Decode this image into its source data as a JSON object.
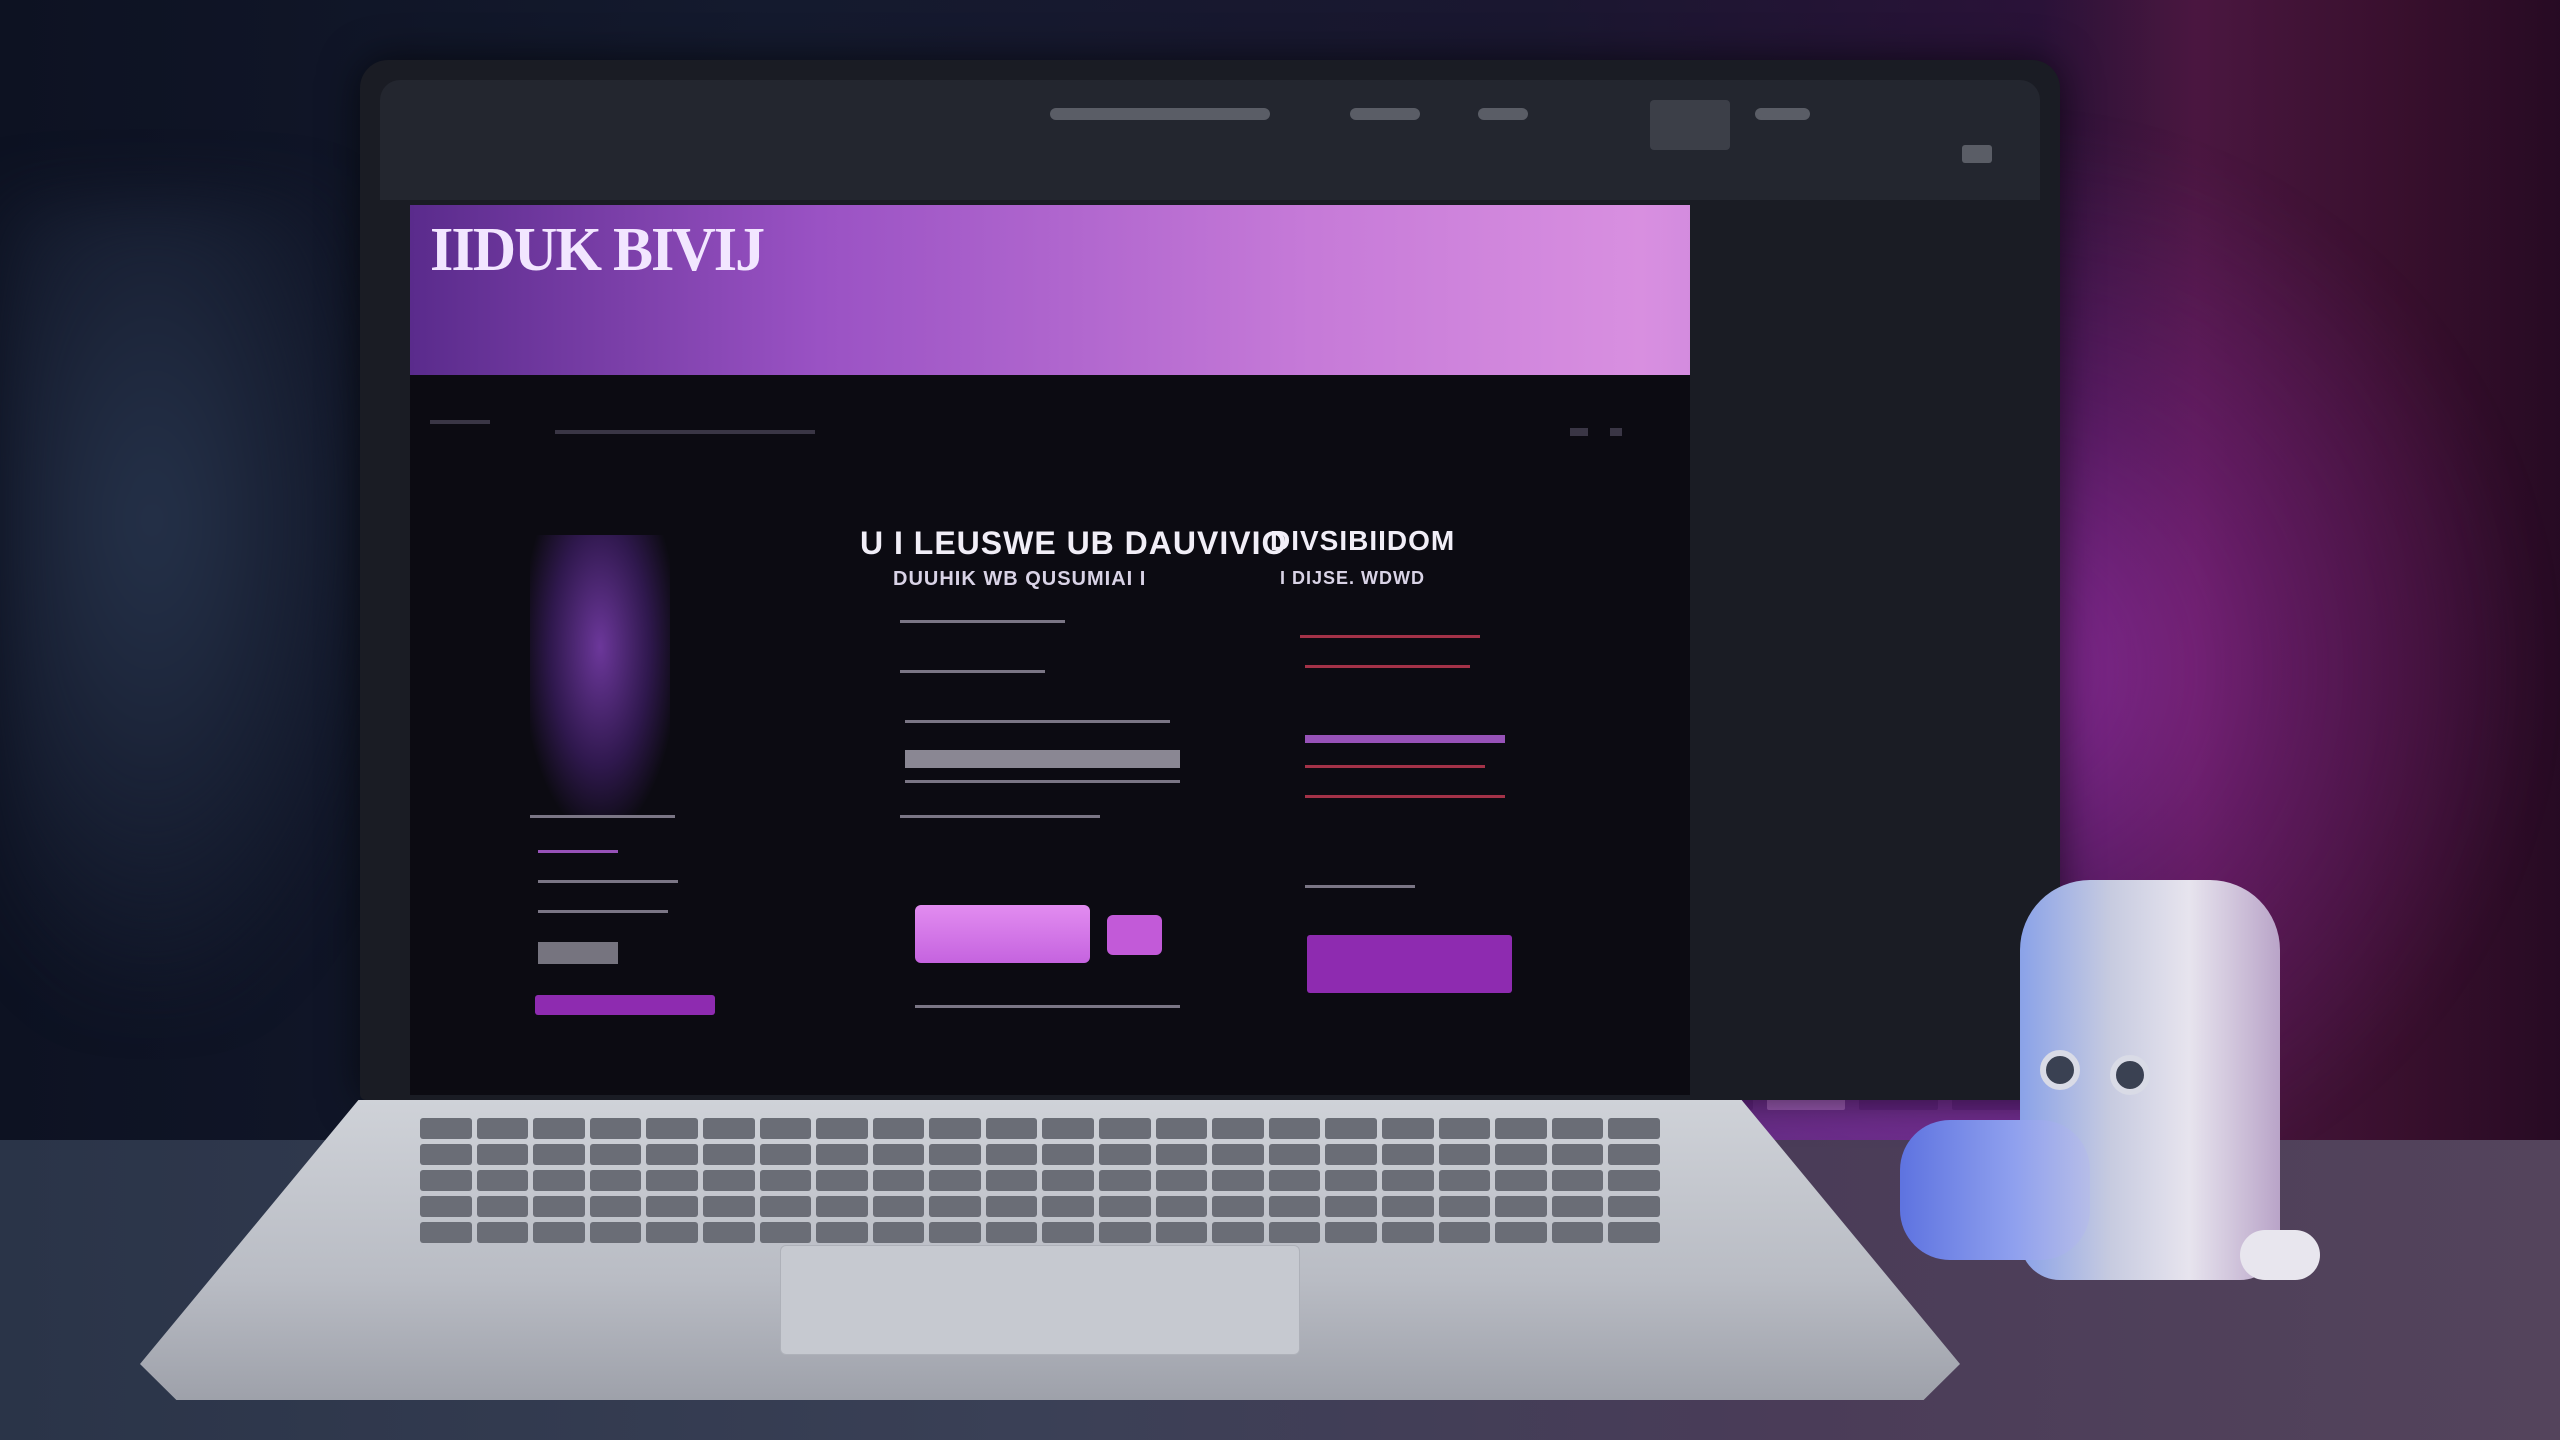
{
  "scene": {
    "description_tag": "",
    "colors": {
      "accent": "#c25ad8",
      "banner_start": "#5a2b8c",
      "banner_end": "#d88fe0",
      "screen_bg": "#0c0b12"
    }
  },
  "site": {
    "logo_text": "IIDUK BIVIJ",
    "col_middle_heading": "U I LEUSWE UB DAUVIVIO",
    "col_middle_subheading": "DUUHIK WB QUSUMIAI I",
    "col_right_heading": "DIVSIBIIDOM",
    "col_right_subheading": "I DIJSE. WDWD"
  }
}
